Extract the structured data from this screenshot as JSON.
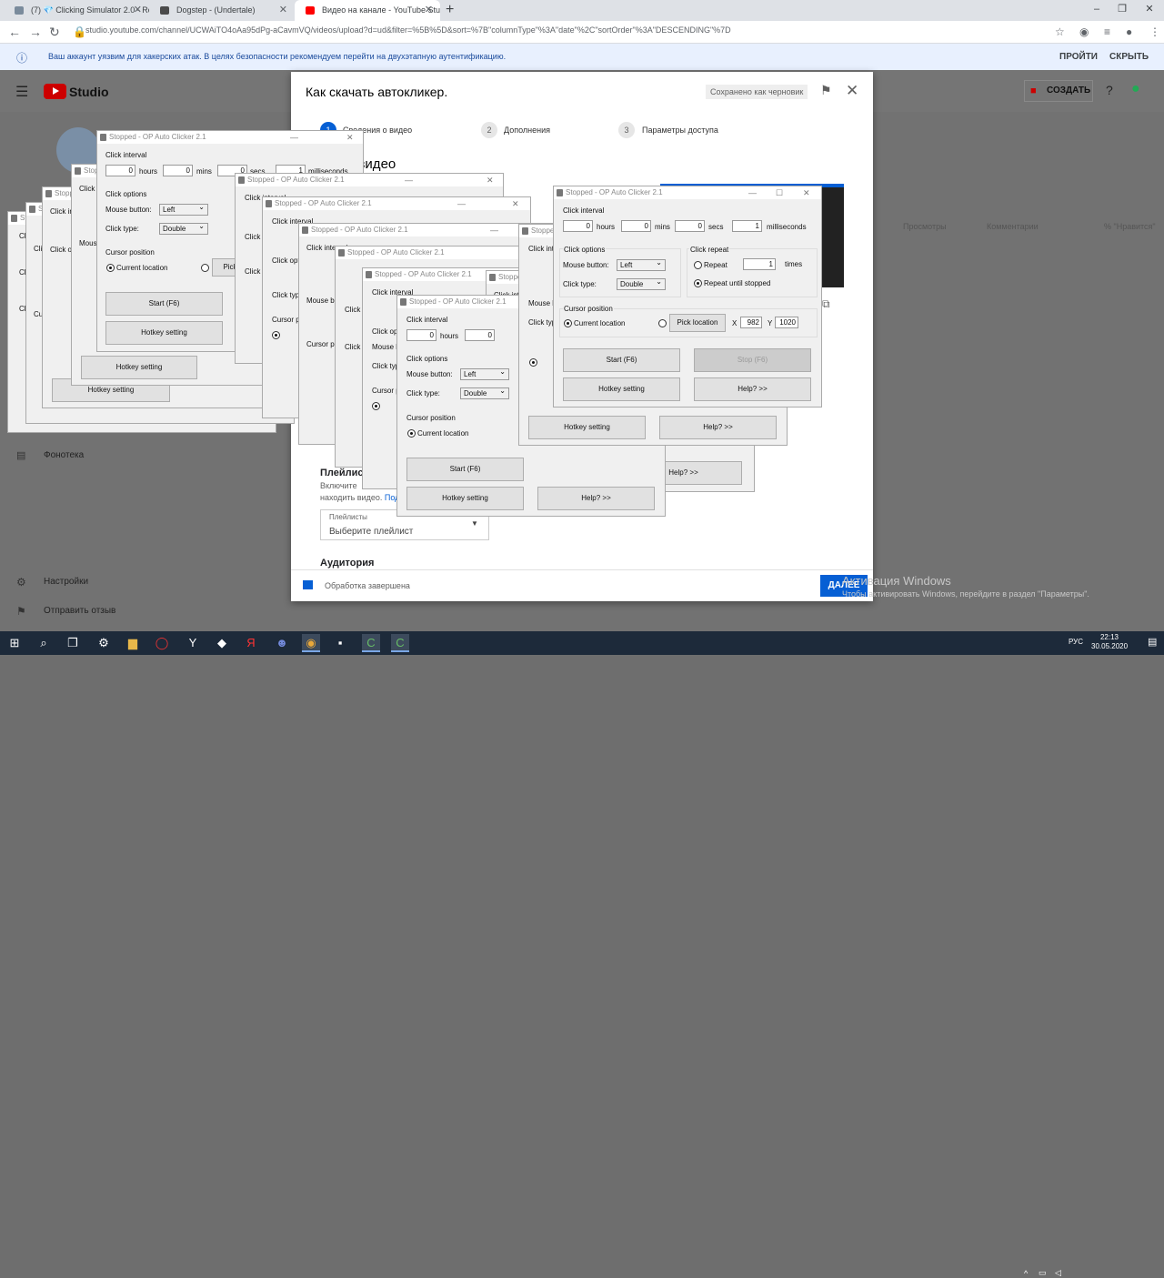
{
  "browser": {
    "tabs": [
      {
        "title": "(7) 💎 Clicking Simulator 2.0 - Ro",
        "color": "#7a8b9c",
        "active": false
      },
      {
        "title": "Dogstep - (Undertale)",
        "color": "#4b4b4b",
        "active": false
      },
      {
        "title": "Видео на канале - YouTube Studi",
        "color": "#ff0000",
        "active": true
      }
    ],
    "new_tab": "+",
    "window_controls": [
      "–",
      "❐",
      "✕"
    ],
    "url": "studio.youtube.com/channel/UCWAiTO4oAa95dPg-aCavmVQ/videos/upload?d=ud&filter=%5B%5D&sort=%7B\"columnType\"%3A\"date\"%2C\"sortOrder\"%3A\"DESCENDING\"%7D",
    "nav": {
      "back": "←",
      "forward": "→",
      "reload": "↻"
    }
  },
  "banner": {
    "message": "Ваш аккаунт уязвим для хакерских атак. В целях безопасности рекомендуем перейти на двухэтапную аутентификацию.",
    "action1": "ПРОЙТИ",
    "action2": "СКРЫТЬ"
  },
  "studio": {
    "logo_text": "Studio",
    "create_label": "СОЗДАТЬ",
    "columns": [
      "Просмотры",
      "Комментарии",
      "% \"Нравится\""
    ],
    "nav": {
      "library": "Фонотека",
      "settings": "Настройки",
      "feedback": "Отправить отзыв"
    }
  },
  "modal": {
    "title": "Как скачать автокликер.",
    "draft": "Сохранено как черновик",
    "steps": [
      {
        "num": "1",
        "label": "Сведения о видео"
      },
      {
        "num": "2",
        "label": "Дополнения"
      },
      {
        "num": "3",
        "label": "Параметры доступа"
      }
    ],
    "section_heading": "ния о видео",
    "playlist_label": "Плейлист",
    "playlist_desc_1": "Включите",
    "playlist_desc_2": "находить видео.",
    "playlist_desc_link": "Под",
    "playlist_field_label": "Плейлисты",
    "playlist_field_value": "Выберите плейлист",
    "audience": "Аудитория",
    "status": "Обработка завершена",
    "next": "ДАЛЕЕ",
    "watermark_title": "Активация Windows",
    "watermark_text": "Чтобы активировать Windows, перейдите в раздел \"Параметры\"."
  },
  "clicker": {
    "title": "Stopped - OP Auto Clicker 2.1",
    "click_interval": "Click interval",
    "hours_val": "0",
    "hours": "hours",
    "mins_val": "0",
    "mins": "mins",
    "secs_val": "0",
    "secs": "secs",
    "ms_val": "1",
    "ms": "milliseconds",
    "click_options": "Click options",
    "mouse_button": "Mouse button:",
    "mouse_button_val": "Left",
    "click_type": "Click type:",
    "click_type_val": "Double",
    "click_repeat": "Click repeat",
    "repeat": "Repeat",
    "repeat_val": "1",
    "times": "times",
    "repeat_until": "Repeat until stopped",
    "cursor_position": "Cursor position",
    "current_location": "Current location",
    "pick_location": "Pick location",
    "pick_short": "Pick",
    "x_label": "X",
    "x_val": "982",
    "y_label": "Y",
    "y_val": "1020",
    "start": "Start (F6)",
    "stop": "Stop (F6)",
    "hotkey": "Hotkey setting",
    "help": "Help? >>"
  },
  "taskbar": {
    "time": "22:13",
    "date": "30.05.2020",
    "lang": "РУС"
  }
}
